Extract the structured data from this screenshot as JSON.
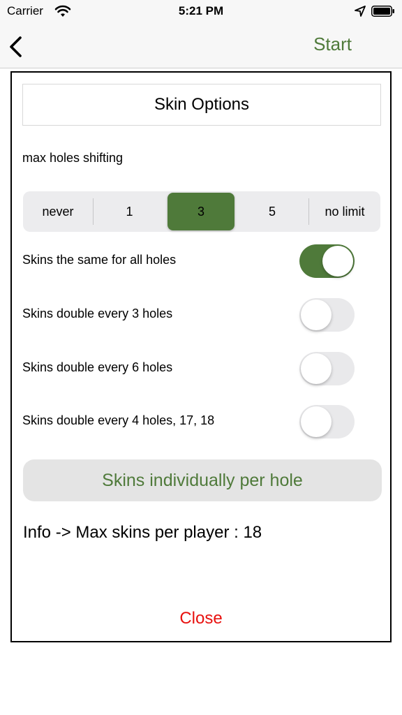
{
  "status_bar": {
    "carrier": "Carrier",
    "time": "5:21 PM"
  },
  "nav": {
    "back_icon": "chevron-left-icon",
    "start_label": "Start"
  },
  "dialog": {
    "title": "Skin Options",
    "shift_label": "max holes shifting",
    "segments": [
      "never",
      "1",
      "3",
      "5",
      "no limit"
    ],
    "selected_segment": "3",
    "toggles": [
      {
        "label": "Skins the same for all holes",
        "on": true
      },
      {
        "label": "Skins double every 3 holes",
        "on": false
      },
      {
        "label": "Skins double every 6 holes",
        "on": false
      },
      {
        "label": "Skins double every 4 holes, 17, 18",
        "on": false
      }
    ],
    "individual_button": "Skins individually per hole",
    "info": "Info -> Max skins per player : 18",
    "close_label": "Close"
  },
  "colors": {
    "accent_green": "#4f7a3a",
    "close_red": "#e8110f"
  }
}
